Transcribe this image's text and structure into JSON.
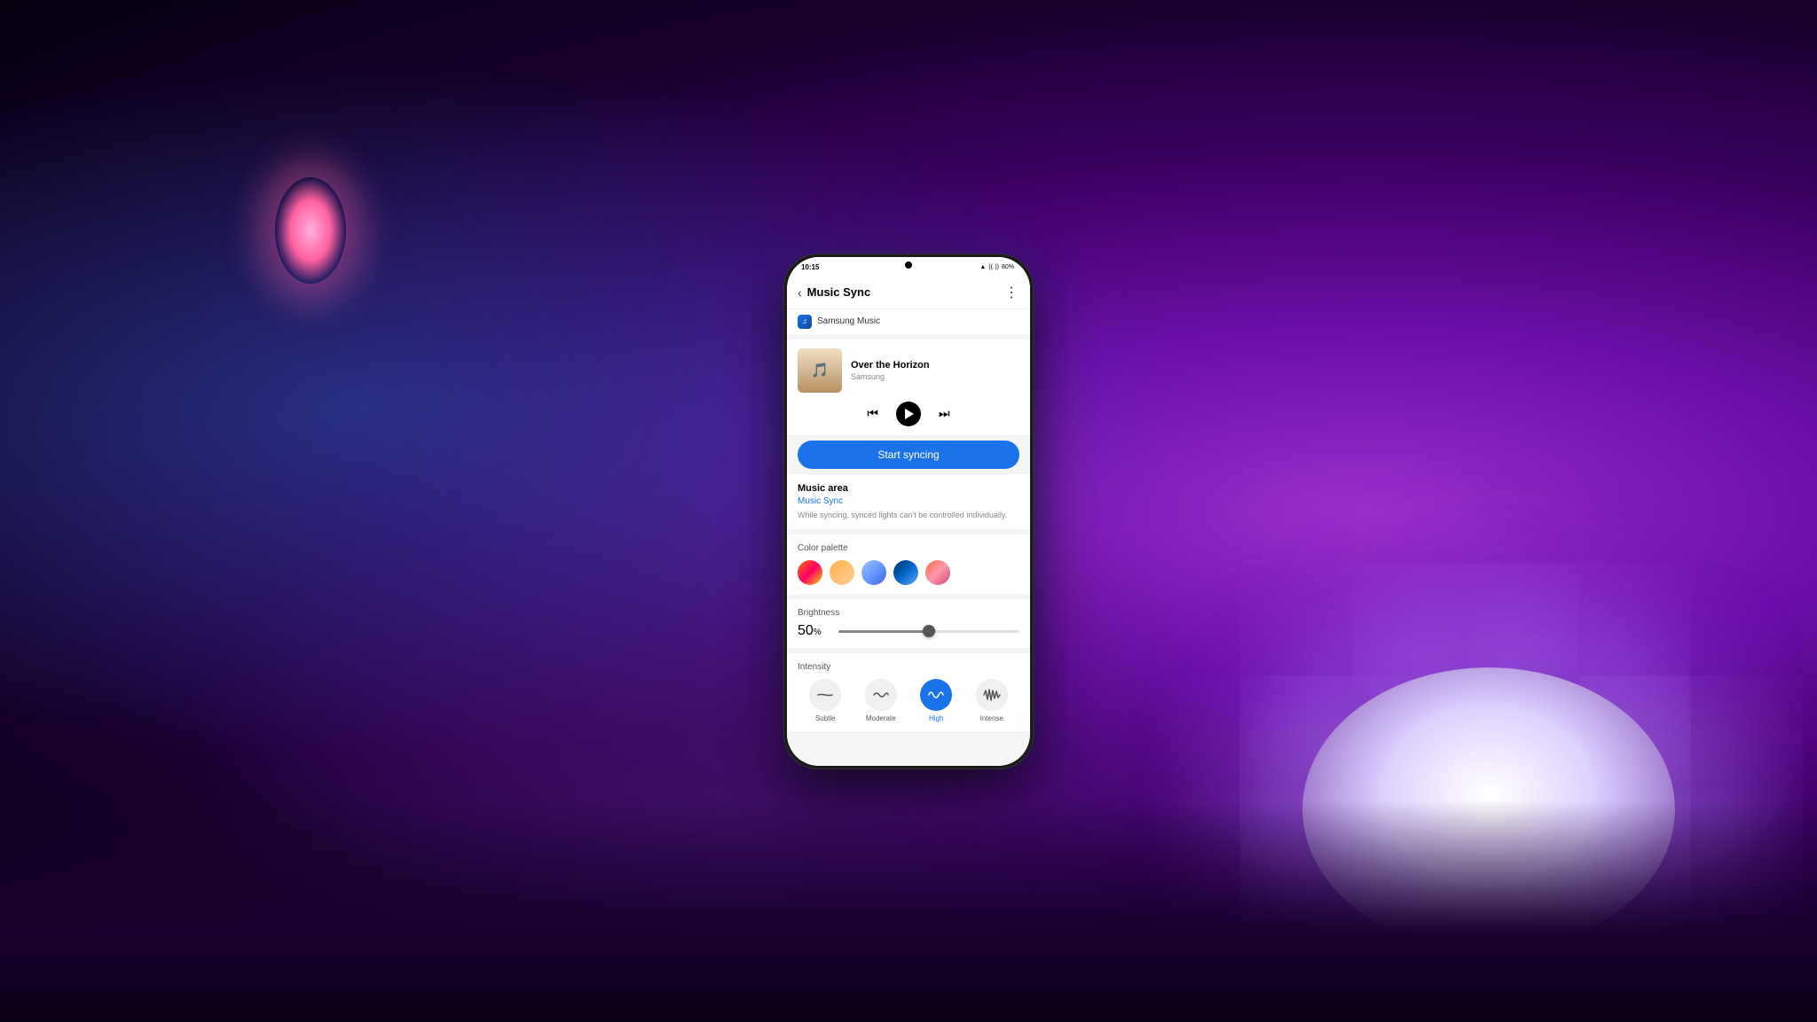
{
  "background": {
    "colors": [
      "#9b2fc9",
      "#6a0fa8",
      "#3a0060",
      "#1a0030"
    ]
  },
  "status_bar": {
    "time": "10:15",
    "signal": "▲",
    "wifi": "WiFi",
    "battery": "80%"
  },
  "header": {
    "title": "Music Sync",
    "back_label": "‹",
    "menu_label": "⋮"
  },
  "music_source": {
    "icon_label": "♪",
    "name": "Samsung Music"
  },
  "player": {
    "song_title": "Over the Horizon",
    "artist": "Samsung",
    "album_art_emoji": "🎵"
  },
  "controls": {
    "prev_label": "⏮",
    "play_label": "▶",
    "next_label": "⏭"
  },
  "sync_button": {
    "label": "Start syncing"
  },
  "music_area": {
    "title": "Music area",
    "link": "Music Sync",
    "description": "While syncing, synced lights can't be controlled individually."
  },
  "color_palette": {
    "label": "Color palette",
    "colors": [
      {
        "id": "warm",
        "gradient": "linear-gradient(135deg, #ff6b00, #ff0066, #ffcc00)"
      },
      {
        "id": "peach",
        "gradient": "linear-gradient(135deg, #ffb347, #ffcc99)"
      },
      {
        "id": "sky",
        "gradient": "linear-gradient(135deg, #a0c4ff, #6699ff, #4466dd)"
      },
      {
        "id": "ocean",
        "gradient": "linear-gradient(135deg, #003366, #0066cc, #66aaff)"
      },
      {
        "id": "sunset",
        "gradient": "linear-gradient(135deg, #ff6644, #ff99aa, #cc4477)"
      }
    ]
  },
  "brightness": {
    "label": "Brightness",
    "value": "50",
    "unit": "%",
    "percent": 50
  },
  "intensity": {
    "label": "Intensity",
    "options": [
      {
        "id": "subtle",
        "name": "Subtle",
        "active": false,
        "wave_type": "flat"
      },
      {
        "id": "moderate",
        "name": "Moderate",
        "active": false,
        "wave_type": "small"
      },
      {
        "id": "high",
        "name": "High",
        "active": true,
        "wave_type": "medium"
      },
      {
        "id": "intense",
        "name": "Intense",
        "active": false,
        "wave_type": "sharp"
      }
    ]
  }
}
